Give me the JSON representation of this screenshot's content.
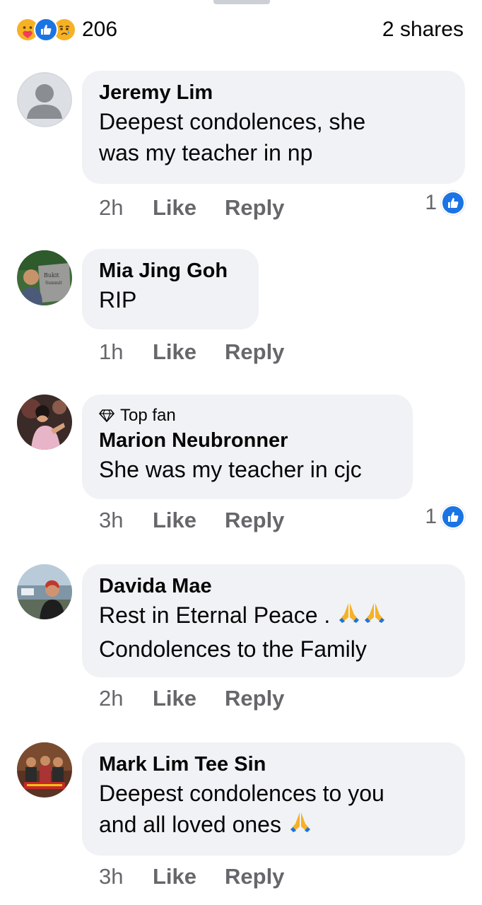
{
  "summary": {
    "reaction_icons": [
      "care-icon",
      "like-icon",
      "sad-icon"
    ],
    "reaction_count": "206",
    "shares": "2 shares"
  },
  "comments": [
    {
      "author": "Jeremy Lim",
      "lines": [
        "Deepest condolences, she",
        "was my teacher in np"
      ],
      "time": "2h",
      "like_label": "Like",
      "reply_label": "Reply",
      "likes": "1",
      "avatar": "default-avatar"
    },
    {
      "author": "Mia Jing Goh",
      "lines": [
        "RIP"
      ],
      "time": "1h",
      "like_label": "Like",
      "reply_label": "Reply",
      "avatar": "photo-avatar"
    },
    {
      "badge": "Top fan",
      "author": "Marion Neubronner",
      "lines": [
        "She was my teacher in cjc"
      ],
      "time": "3h",
      "like_label": "Like",
      "reply_label": "Reply",
      "likes": "1",
      "avatar": "photo-avatar"
    },
    {
      "author": "Davida Mae",
      "lines": [
        "Rest in Eternal Peace .",
        "Condolences to the Family"
      ],
      "emoji": "praying-hands-icon",
      "time": "2h",
      "like_label": "Like",
      "reply_label": "Reply",
      "avatar": "photo-avatar"
    },
    {
      "author": "Mark Lim Tee Sin",
      "lines": [
        "Deepest condolences to you",
        "and all loved ones"
      ],
      "emoji": "praying-hands-icon",
      "time": "3h",
      "like_label": "Like",
      "reply_label": "Reply",
      "avatar": "photo-avatar"
    }
  ],
  "colors": {
    "bubble": "#f0f2f5",
    "meta": "#65676b",
    "like_blue": "#1b74e4",
    "care_yellow": "#f7b125"
  }
}
